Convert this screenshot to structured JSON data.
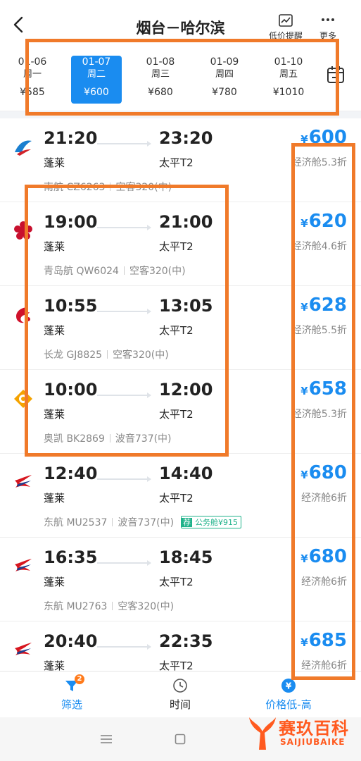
{
  "header": {
    "title": "烟台－哈尔滨",
    "low_price_label": "低价提醒",
    "more_label": "更多"
  },
  "dates": [
    {
      "date": "01-06",
      "weekday": "周一",
      "price": "¥585"
    },
    {
      "date": "01-07",
      "weekday": "周二",
      "price": "¥600"
    },
    {
      "date": "01-08",
      "weekday": "周三",
      "price": "¥680"
    },
    {
      "date": "01-09",
      "weekday": "周四",
      "price": "¥780"
    },
    {
      "date": "01-10",
      "weekday": "周五",
      "price": "¥1010"
    }
  ],
  "flights": [
    {
      "dep_time": "21:20",
      "arr_time": "23:20",
      "dep_airport": "蓬莱",
      "arr_airport": "太平T2",
      "airline": "南航 CZ6263",
      "aircraft": "空客320(中)",
      "price": "600",
      "cabin": "经济舱5.3折",
      "logo": "china-southern-logo"
    },
    {
      "dep_time": "19:00",
      "arr_time": "21:00",
      "dep_airport": "蓬莱",
      "arr_airport": "太平T2",
      "airline": "青岛航 QW6024",
      "aircraft": "空客320(中)",
      "price": "620",
      "cabin": "经济舱4.6折",
      "logo": "qingdao-airlines-logo"
    },
    {
      "dep_time": "10:55",
      "arr_time": "13:05",
      "dep_airport": "蓬莱",
      "arr_airport": "太平T2",
      "airline": "长龙 GJ8825",
      "aircraft": "空客320(中)",
      "price": "628",
      "cabin": "经济舱5.5折",
      "logo": "loong-air-logo"
    },
    {
      "dep_time": "10:00",
      "arr_time": "12:00",
      "dep_airport": "蓬莱",
      "arr_airport": "太平T2",
      "airline": "奥凯 BK2869",
      "aircraft": "波音737(中)",
      "price": "658",
      "cabin": "经济舱5.3折",
      "logo": "okay-airways-logo"
    },
    {
      "dep_time": "12:40",
      "arr_time": "14:40",
      "dep_airport": "蓬莱",
      "arr_airport": "太平T2",
      "airline": "东航 MU2537",
      "aircraft": "波音737(中)",
      "price": "680",
      "cabin": "经济舱6折",
      "logo": "china-eastern-logo",
      "tag_jian": "荐",
      "tag_text": "公务舱¥915"
    },
    {
      "dep_time": "16:35",
      "arr_time": "18:45",
      "dep_airport": "蓬莱",
      "arr_airport": "太平T2",
      "airline": "东航 MU2763",
      "aircraft": "空客320(中)",
      "price": "680",
      "cabin": "经济舱6折",
      "logo": "china-eastern-logo"
    },
    {
      "dep_time": "20:40",
      "arr_time": "22:35",
      "dep_airport": "蓬莱",
      "arr_airport": "太平T2",
      "airline": "",
      "aircraft": "",
      "price": "685",
      "cabin": "经济舱6折",
      "logo": "china-eastern-logo"
    }
  ],
  "currency": "¥",
  "bottom": {
    "filter_label": "筛选",
    "filter_badge": "2",
    "time_label": "时间",
    "price_label": "价格低-高",
    "price_icon": "¥"
  },
  "watermark": {
    "cn": "赛玖百科",
    "en": "SAIJIUBAIKE"
  },
  "colors": {
    "accent": "#1a8cf0",
    "highlight": "#f07a2a",
    "tag_green": "#1fb28a"
  }
}
